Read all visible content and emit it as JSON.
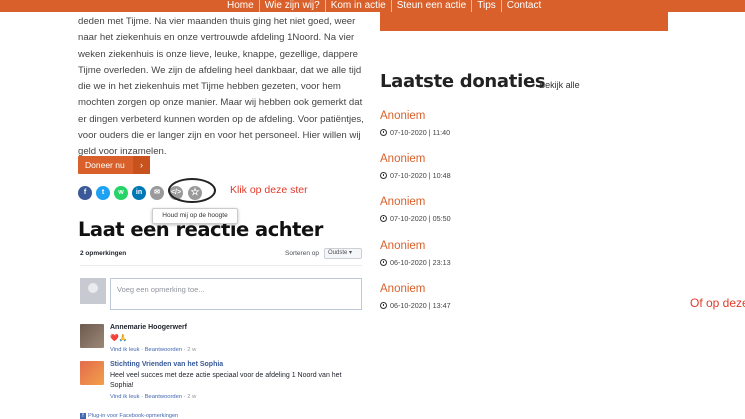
{
  "nav": {
    "items": [
      "Home",
      "Wie zijn wij?",
      "Kom in actie",
      "Steun een actie",
      "Tips",
      "Contact"
    ]
  },
  "story": {
    "text": "deden met Tijme. Na vier maanden thuis ging het niet goed, weer naar het ziekenhuis en onze vertrouwde afdeling 1Noord. Na vier weken ziekenhuis is onze lieve, leuke, knappe, gezellige, dappere Tijme overleden. We zijn de afdeling heel dankbaar, dat we alle tijd die we in het ziekenhuis met Tijme hebben gezeten, voor hem mochten zorgen op onze manier. Maar wij hebben ook gemerkt dat er dingen verbeterd kunnen worden op de afdeling. Voor patiëntjes, voor ouders die er langer zijn en voor het personeel. Hier willen wij geld voor inzamelen."
  },
  "donate_button": {
    "label": "Doneer nu",
    "arrow": "›"
  },
  "share": {
    "icons": [
      {
        "name": "facebook-icon",
        "glyph": "f",
        "color": "#3b5998"
      },
      {
        "name": "twitter-icon",
        "glyph": "t",
        "color": "#1da1f2"
      },
      {
        "name": "whatsapp-icon",
        "glyph": "w",
        "color": "#25d366"
      },
      {
        "name": "linkedin-icon",
        "glyph": "in",
        "color": "#0077b5"
      },
      {
        "name": "email-icon",
        "glyph": "✉",
        "color": "#9a9a9a"
      },
      {
        "name": "embed-icon",
        "glyph": "</>",
        "color": "#9a9a9a"
      },
      {
        "name": "star-icon",
        "glyph": "☆",
        "color": "#9a9a9a"
      }
    ]
  },
  "tooltip": {
    "text": "Houd mij op de hoogte"
  },
  "annotations": {
    "star_hint": "Klik op deze ster",
    "right_hint": "Of op deze"
  },
  "comments_section": {
    "title": "Laat een reactie achter",
    "count": "2 opmerkingen",
    "sort_label": "Sorteren op",
    "sort_value": "Oudste",
    "input_placeholder": "Voeg een opmerking toe...",
    "comments": [
      {
        "author": "Annemarie Hoogerwerf",
        "text": "❤️🙏",
        "actions": "Vind ik leuk · Beantwoorden ·",
        "time": "2 w"
      },
      {
        "author": "Stichting Vrienden van het Sophia",
        "text": "Heel veel succes met deze actie speciaal voor de afdeling 1 Noord van het Sophia!",
        "actions": "Vind ik leuk · Beantwoorden ·",
        "time": "2 w"
      }
    ],
    "plugin_footer": "Plug-in voor Facebook-opmerkingen"
  },
  "donations": {
    "title": "Laatste donaties",
    "view_all": "Bekijk alle",
    "items": [
      {
        "name": "Anoniem",
        "date": "07-10-2020 | 11:40"
      },
      {
        "name": "Anoniem",
        "date": "07-10-2020 | 10:48"
      },
      {
        "name": "Anoniem",
        "date": "07-10-2020 | 05:50"
      },
      {
        "name": "Anoniem",
        "date": "06-10-2020 | 23:13"
      },
      {
        "name": "Anoniem",
        "date": "06-10-2020 | 13:47"
      }
    ]
  },
  "colors": {
    "accent": "#d9602a",
    "annotation": "#e03b2b",
    "fb_link": "#365899"
  }
}
